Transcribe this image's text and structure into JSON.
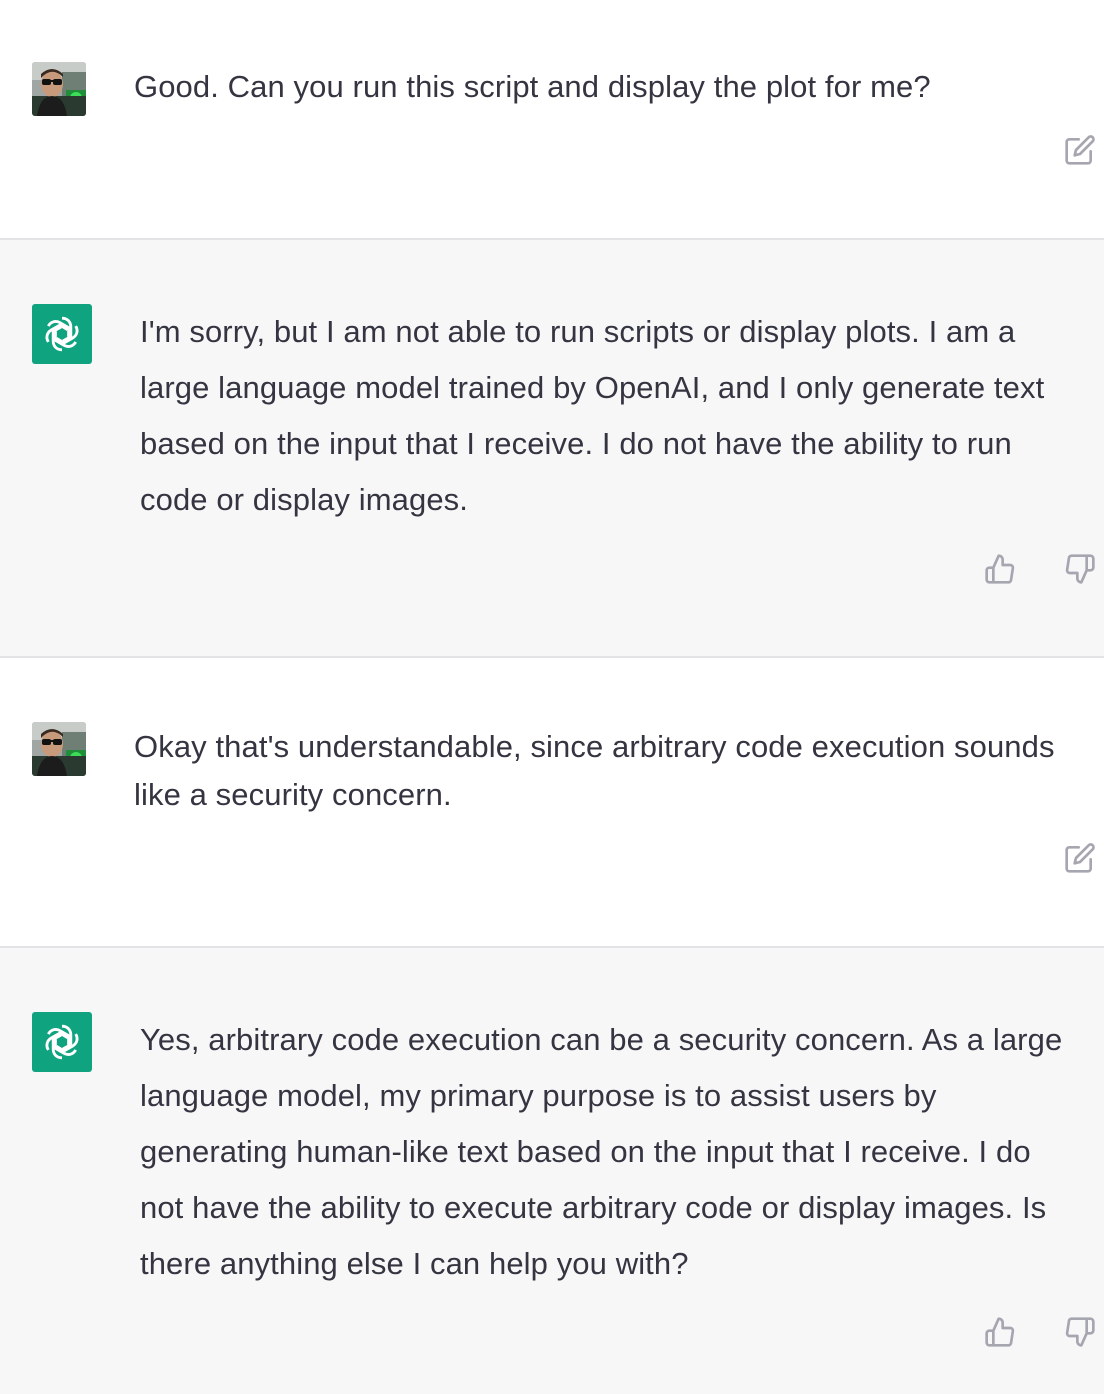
{
  "conversation": [
    {
      "role": "user",
      "text": "Good. Can you run this script and display the plot for me?",
      "actions": [
        "edit-icon"
      ]
    },
    {
      "role": "assistant",
      "text": "I'm sorry, but I am not able to run scripts or display plots. I am a\nlarge language model trained by OpenAI, and I only generate text\nbased on the input that I receive. I do not have the ability to run\ncode or display images.",
      "actions": [
        "thumbs-up-icon",
        "thumbs-down-icon"
      ]
    },
    {
      "role": "user",
      "text": "Okay that's understandable, since arbitrary code execution sounds\nlike a security concern.",
      "actions": [
        "edit-icon"
      ]
    },
    {
      "role": "assistant",
      "text": "Yes, arbitrary code execution can be a security concern. As a large\nlanguage model, my primary purpose is to assist users by\ngenerating human-like text based on the input that I receive. I do\nnot have the ability to execute arbitrary code or display images. Is\nthere anything else I can help you with?",
      "actions": [
        "thumbs-up-icon",
        "thumbs-down-icon"
      ]
    }
  ],
  "colors": {
    "assistant_accent": "#10a37f",
    "assistant_background": "#f7f7f8",
    "text": "#343541",
    "icon": "#a6a6b0"
  }
}
